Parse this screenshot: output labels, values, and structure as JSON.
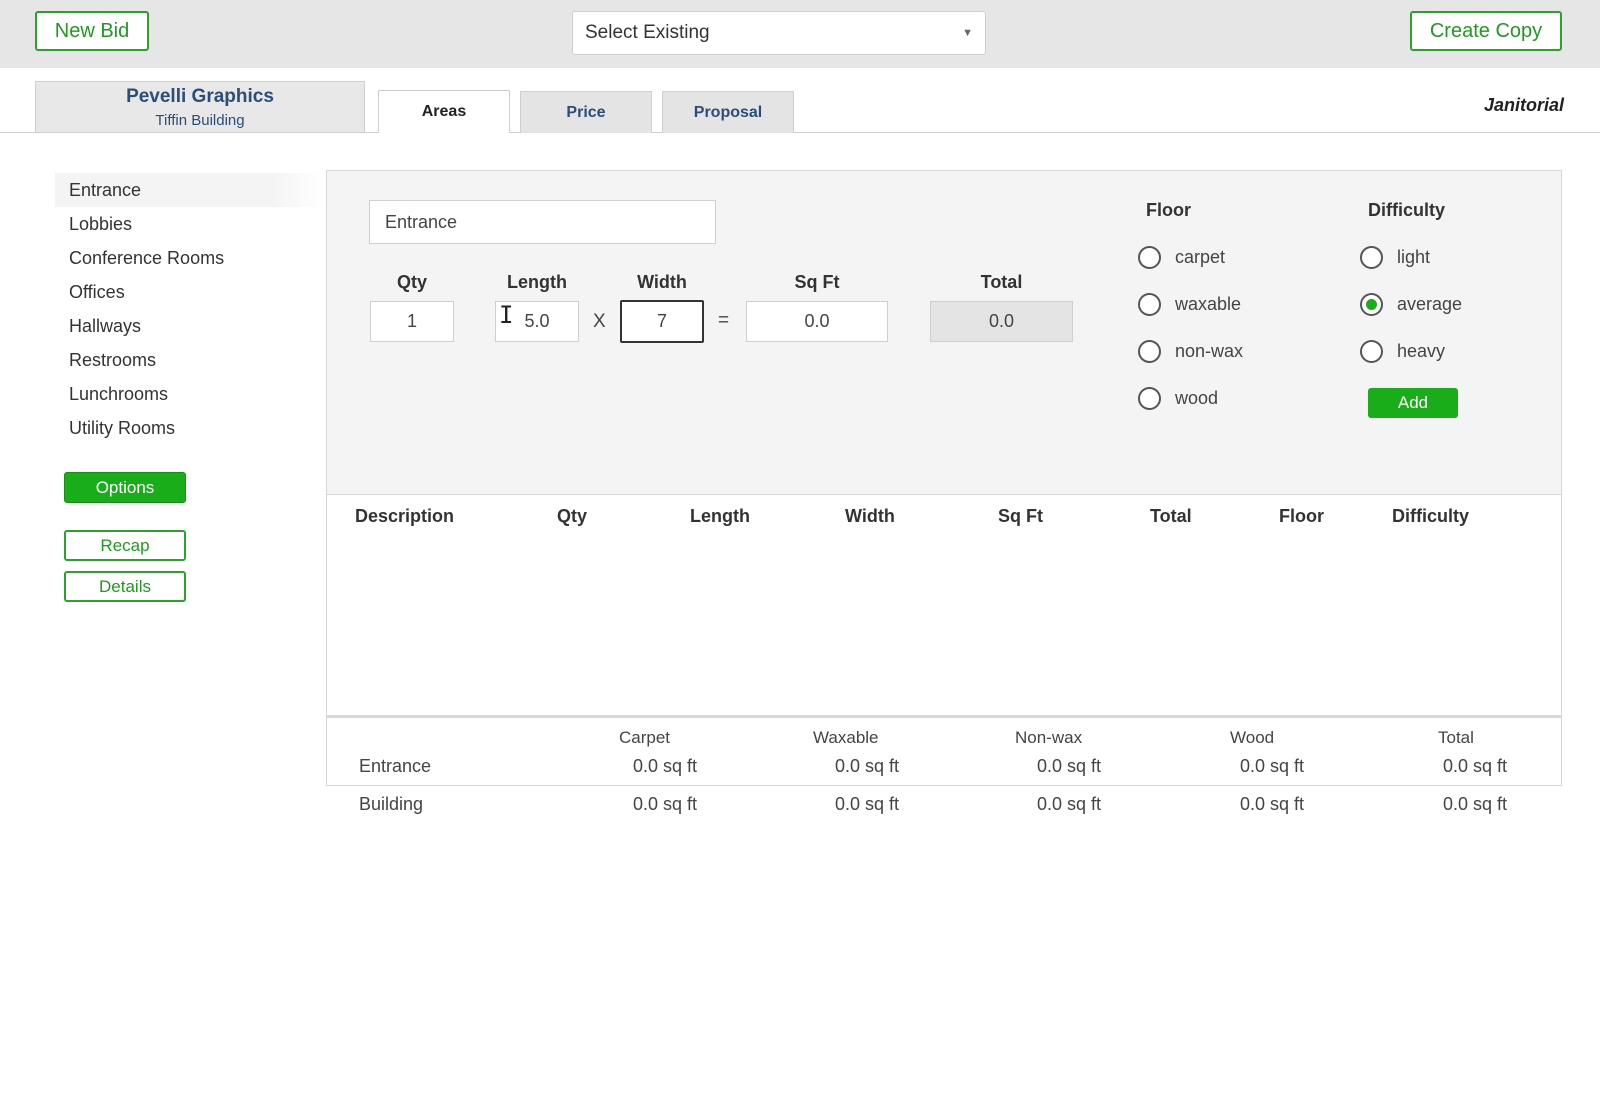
{
  "topbar": {
    "new_bid": "New Bid",
    "select_existing": "Select Existing",
    "create_copy": "Create Copy"
  },
  "header": {
    "client_name": "Pevelli Graphics",
    "building": "Tiffin Building",
    "tabs": [
      {
        "label": "Areas",
        "active": true
      },
      {
        "label": "Price",
        "active": false
      },
      {
        "label": "Proposal",
        "active": false
      }
    ],
    "department": "Janitorial"
  },
  "sidebar": {
    "items": [
      {
        "label": "Entrance",
        "selected": true
      },
      {
        "label": "Lobbies"
      },
      {
        "label": "Conference Rooms"
      },
      {
        "label": "Offices"
      },
      {
        "label": "Hallways"
      },
      {
        "label": "Restrooms"
      },
      {
        "label": "Lunchrooms"
      },
      {
        "label": "Utility Rooms"
      }
    ],
    "options": "Options",
    "recap": "Recap",
    "details": "Details"
  },
  "form": {
    "description": "Entrance",
    "labels": {
      "qty": "Qty",
      "length": "Length",
      "width": "Width",
      "sqft": "Sq Ft",
      "total": "Total"
    },
    "qty": "1",
    "length": "5.0",
    "width": "7",
    "times": "X",
    "equals": "=",
    "sqft": "0.0",
    "total": "0.0",
    "floor": {
      "title": "Floor",
      "options": [
        "carpet",
        "waxable",
        "non-wax",
        "wood"
      ],
      "selected": null
    },
    "difficulty": {
      "title": "Difficulty",
      "options": [
        "light",
        "average",
        "heavy"
      ],
      "selected": "average"
    },
    "add": "Add"
  },
  "table": {
    "columns": [
      "Description",
      "Qty",
      "Length",
      "Width",
      "Sq Ft",
      "Total",
      "Floor",
      "Difficulty"
    ],
    "rows": []
  },
  "summary": {
    "columns": [
      "Carpet",
      "Waxable",
      "Non-wax",
      "Wood",
      "Total"
    ],
    "rows": [
      {
        "label": "Entrance",
        "values": [
          "0.0 sq ft",
          "0.0 sq ft",
          "0.0 sq ft",
          "0.0 sq ft",
          "0.0 sq ft"
        ]
      },
      {
        "label": "Building",
        "values": [
          "0.0 sq ft",
          "0.0 sq ft",
          "0.0 sq ft",
          "0.0 sq ft",
          "0.0 sq ft"
        ]
      }
    ]
  },
  "colors": {
    "accent_green": "#1aad1a",
    "link_blue": "#2a4d7a"
  }
}
